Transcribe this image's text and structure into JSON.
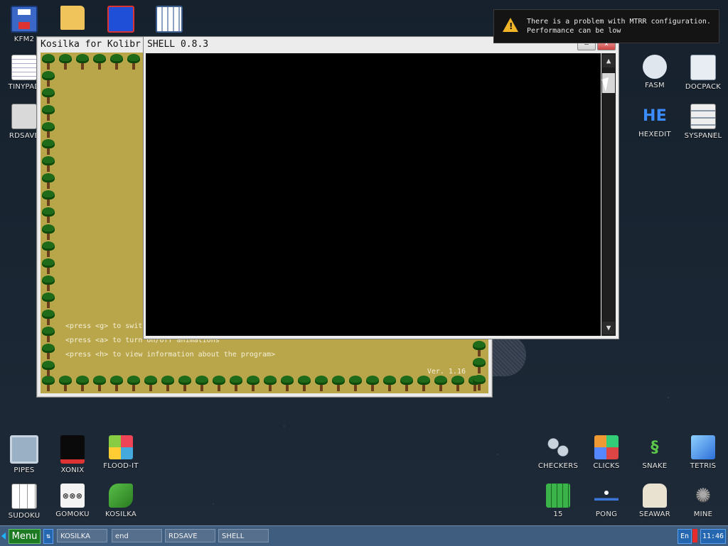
{
  "desktop": {
    "icons_left": [
      {
        "label": "KFM2",
        "icon": "floppy-disk-icon"
      },
      {
        "label": "",
        "icon": "folder-icon"
      },
      {
        "label": "",
        "icon": "board-icon"
      },
      {
        "label": "",
        "icon": "calculator-icon"
      },
      {
        "label": "TINYPAD",
        "icon": "notepad-icon"
      },
      {
        "label": "RDSAVE",
        "icon": "rdsave-icon"
      }
    ],
    "icons_right": [
      {
        "label": "FASM",
        "icon": "fasm-icon"
      },
      {
        "label": "DOCPACK",
        "icon": "docpack-icon"
      },
      {
        "label": "HEXEDIT",
        "icon": "hexedit-icon",
        "glyph": "HE"
      },
      {
        "label": "SYSPANEL",
        "icon": "syspanel-icon"
      }
    ],
    "icons_bottom": [
      {
        "label": "PIPES",
        "icon": "pipes-icon"
      },
      {
        "label": "XONIX",
        "icon": "xonix-icon"
      },
      {
        "label": "FLOOD-IT",
        "icon": "flood-it-icon"
      },
      {
        "label": "CHECKERS",
        "icon": "checkers-icon"
      },
      {
        "label": "CLICKS",
        "icon": "clicks-icon"
      },
      {
        "label": "SNAKE",
        "icon": "snake-icon"
      },
      {
        "label": "TETRIS",
        "icon": "tetris-icon"
      },
      {
        "label": "SUDOKU",
        "icon": "sudoku-icon"
      },
      {
        "label": "GOMOKU",
        "icon": "gomoku-icon"
      },
      {
        "label": "KOSILKA",
        "icon": "kosilka-icon"
      },
      {
        "label": "15",
        "icon": "fifteen-icon"
      },
      {
        "label": "PONG",
        "icon": "pong-icon"
      },
      {
        "label": "SEAWAR",
        "icon": "seawar-icon"
      },
      {
        "label": "MINE",
        "icon": "mine-icon"
      }
    ]
  },
  "kosilka_window": {
    "title": "Kosilka for Kolibr",
    "lines": [
      "<press <g> to switc",
      "<press <a> to turn on/off animations",
      "<press <h> to view information about the program>"
    ],
    "version": "Ver. 1.16"
  },
  "shell_window": {
    "title": "SHELL 0.8.3",
    "minimize": "–",
    "close": "×",
    "scroll_up": "▲",
    "scroll_down": "▼"
  },
  "notification": {
    "line1": "There is a problem with MTRR configuration.",
    "line2": "Performance can be low",
    "icon_mark": "!"
  },
  "taskbar": {
    "menu_label": "Menu",
    "swap_label": "⇅",
    "buttons": [
      "KOSILKA",
      "end",
      "RDSAVE",
      "SHELL"
    ],
    "lang": "En",
    "clock": "11:46"
  }
}
